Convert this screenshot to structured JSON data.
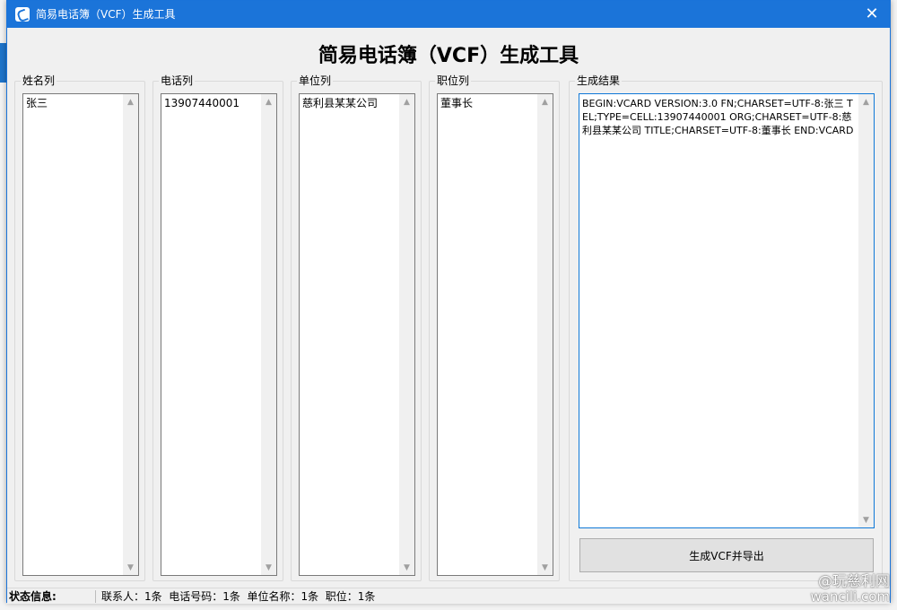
{
  "window": {
    "title": "简易电话簿（VCF）生成工具",
    "close_glyph": "✕",
    "icon": "phone-app-icon",
    "accent_color": "#1b74d9"
  },
  "heading": "简易电话簿（VCF）生成工具",
  "columns": [
    {
      "label": "姓名列",
      "value": "张三"
    },
    {
      "label": "电话列",
      "value": "13907440001"
    },
    {
      "label": "单位列",
      "value": "慈利县某某公司"
    },
    {
      "label": "职位列",
      "value": "董事长"
    }
  ],
  "result": {
    "label": "生成结果",
    "value": "BEGIN:VCARD VERSION:3.0 FN;CHARSET=UTF-8:张三 TEL;TYPE=CELL:13907440001 ORG;CHARSET=UTF-8:慈利县某某公司 TITLE;CHARSET=UTF-8:董事长 END:VCARD"
  },
  "generate_button": "生成VCF并导出",
  "status": {
    "label": "状态信息:",
    "text": "联系人：1条  电话号码：1条  单位名称：1条  职位：1条"
  },
  "watermark": {
    "line1": "@玩慈利网",
    "line2": "wancili.com"
  }
}
